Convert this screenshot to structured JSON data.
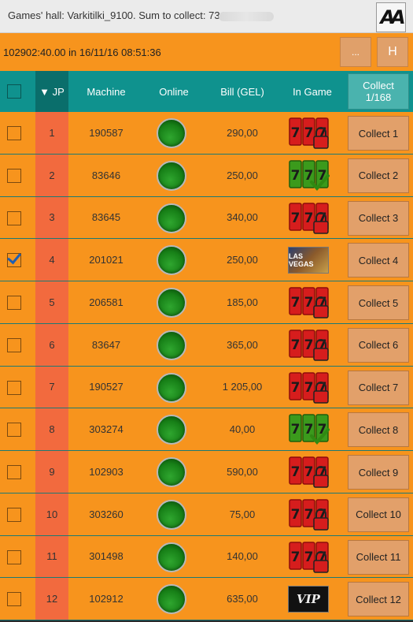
{
  "titlebar": {
    "text": "Games' hall: Varkitilki_9100. Sum to collect: 73",
    "logo_text": "AA"
  },
  "infobar": {
    "text": "102902:40.00  in 16/11/16 08:51:36",
    "more_label": "...",
    "h_label": "H"
  },
  "header": {
    "jp": "▼ JP",
    "machine": "Machine",
    "online": "Online",
    "bill": "Bill (GEL)",
    "in_game": "In Game",
    "collect_line1": "Collect",
    "collect_line2": "1/168"
  },
  "colors": {
    "orange_bg": "#f7941d",
    "header_teal": "#0f928e",
    "jp_column": "#f26a3e",
    "online_green": "#178017"
  },
  "rows": [
    {
      "jp": "1",
      "machine": "190587",
      "bill": "290,00",
      "status": "locked",
      "checked": false,
      "collect": "Collect 1"
    },
    {
      "jp": "2",
      "machine": "83646",
      "bill": "250,00",
      "status": "available",
      "checked": false,
      "collect": "Collect 2"
    },
    {
      "jp": "3",
      "machine": "83645",
      "bill": "340,00",
      "status": "locked",
      "checked": false,
      "collect": "Collect 3"
    },
    {
      "jp": "4",
      "machine": "201021",
      "bill": "250,00",
      "status": "vegas",
      "checked": true,
      "collect": "Collect 4"
    },
    {
      "jp": "5",
      "machine": "206581",
      "bill": "185,00",
      "status": "locked",
      "checked": false,
      "collect": "Collect 5"
    },
    {
      "jp": "6",
      "machine": "83647",
      "bill": "365,00",
      "status": "locked",
      "checked": false,
      "collect": "Collect 6"
    },
    {
      "jp": "7",
      "machine": "190527",
      "bill": "1 205,00",
      "status": "locked",
      "checked": false,
      "collect": "Collect 7"
    },
    {
      "jp": "8",
      "machine": "303274",
      "bill": "40,00",
      "status": "available",
      "checked": false,
      "collect": "Collect 8"
    },
    {
      "jp": "9",
      "machine": "102903",
      "bill": "590,00",
      "status": "locked",
      "checked": false,
      "collect": "Collect 9"
    },
    {
      "jp": "10",
      "machine": "303260",
      "bill": "75,00",
      "status": "locked",
      "checked": false,
      "collect": "Collect 10"
    },
    {
      "jp": "11",
      "machine": "301498",
      "bill": "140,00",
      "status": "locked",
      "checked": false,
      "collect": "Collect 11"
    },
    {
      "jp": "12",
      "machine": "102912",
      "bill": "635,00",
      "status": "vip",
      "checked": false,
      "collect": "Collect 12"
    }
  ],
  "thumbs": {
    "vegas_text": "LAS VEGAS",
    "vip_text": "VIP"
  }
}
